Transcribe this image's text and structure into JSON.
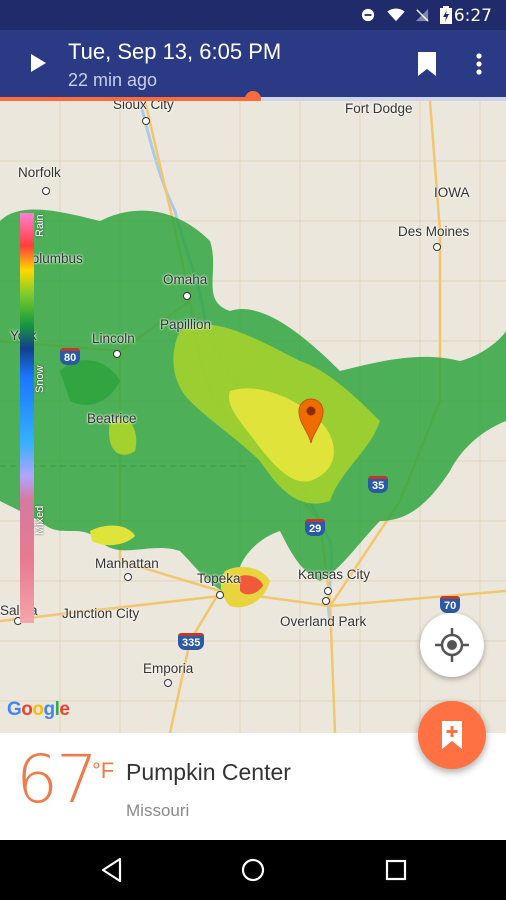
{
  "status_bar": {
    "time": "6:27",
    "icons": [
      "do-not-disturb-icon",
      "wifi-icon",
      "no-signal-icon",
      "battery-charging-icon"
    ]
  },
  "app_bar": {
    "timestamp": "Tue, Sep 13, 6:05 PM",
    "age": "22 min ago",
    "play_icon": "play-icon",
    "bookmark_icon": "bookmark-icon",
    "more_icon": "more-vert-icon"
  },
  "timeline": {
    "progress": 0.5
  },
  "map": {
    "attribution": "Google",
    "cities": [
      {
        "name": "Sioux City"
      },
      {
        "name": "Fort Dodge"
      },
      {
        "name": "Norfolk"
      },
      {
        "name": "IOWA"
      },
      {
        "name": "Des Moines"
      },
      {
        "name": "Columbus"
      },
      {
        "name": "Omaha"
      },
      {
        "name": "Papillion"
      },
      {
        "name": "Lincoln"
      },
      {
        "name": "York"
      },
      {
        "name": "Beatrice"
      },
      {
        "name": "Manhattan"
      },
      {
        "name": "Topeka"
      },
      {
        "name": "Kansas City"
      },
      {
        "name": "Junction City"
      },
      {
        "name": "Overland Park"
      },
      {
        "name": "Salina"
      },
      {
        "name": "Emporia"
      }
    ],
    "highways": [
      "80",
      "35",
      "29",
      "335",
      "70"
    ],
    "legend": {
      "labels": [
        "Rain",
        "Snow",
        "Mixed"
      ]
    },
    "marker_icon": "map-pin-icon",
    "locate_icon": "my-location-icon"
  },
  "fab": {
    "icon": "bookmark-add-icon"
  },
  "current": {
    "temperature": "67",
    "unit": "°F",
    "location": "Pumpkin Center",
    "region": "Missouri"
  },
  "nav_bar": {
    "icons": [
      "back-icon",
      "home-icon",
      "recents-icon"
    ]
  },
  "colors": {
    "status_bar": "#1f2b6a",
    "app_bar": "#2b3a84",
    "accent": "#ff6b3d",
    "temperature": "#f07b4a"
  }
}
